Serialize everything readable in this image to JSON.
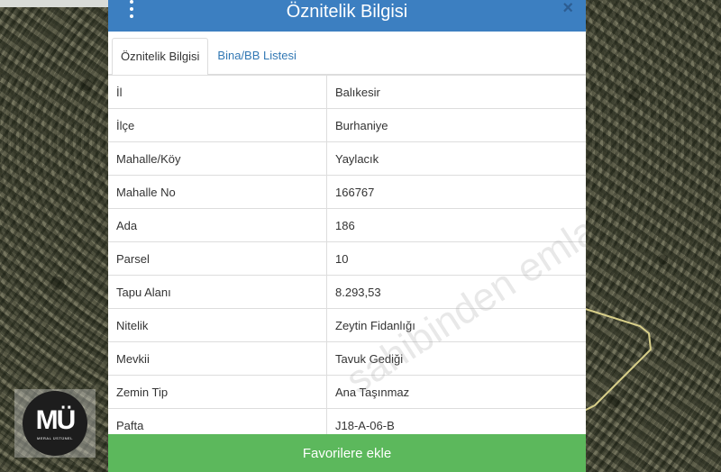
{
  "panel": {
    "title": "Öznitelik Bilgisi",
    "close_label": "×",
    "tabs": [
      {
        "label": "Öznitelik Bilgisi",
        "active": true
      },
      {
        "label": "Bina/BB Listesi",
        "active": false
      }
    ],
    "rows": [
      {
        "key": "İl",
        "value": "Balıkesir"
      },
      {
        "key": "İlçe",
        "value": "Burhaniye"
      },
      {
        "key": "Mahalle/Köy",
        "value": "Yaylacık"
      },
      {
        "key": "Mahalle No",
        "value": "166767"
      },
      {
        "key": "Ada",
        "value": "186"
      },
      {
        "key": "Parsel",
        "value": "10"
      },
      {
        "key": "Tapu Alanı",
        "value": "8.293,53"
      },
      {
        "key": "Nitelik",
        "value": "Zeytin Fidanlığı"
      },
      {
        "key": "Mevkii",
        "value": "Tavuk Gediği"
      },
      {
        "key": "Zemin Tip",
        "value": "Ana Taşınmaz"
      },
      {
        "key": "Pafta",
        "value": "J18-A-06-B"
      }
    ],
    "favorite_button": "Favorilere ekle",
    "watermark": "sahibinden emlakjet.com"
  },
  "logo": {
    "mark": "MÜ",
    "subtitle": "MERAL ÜSTÜNEL"
  },
  "colors": {
    "header": "#3c7fc1",
    "button": "#5cb85c",
    "parcel_line": "#d8cf8a"
  }
}
